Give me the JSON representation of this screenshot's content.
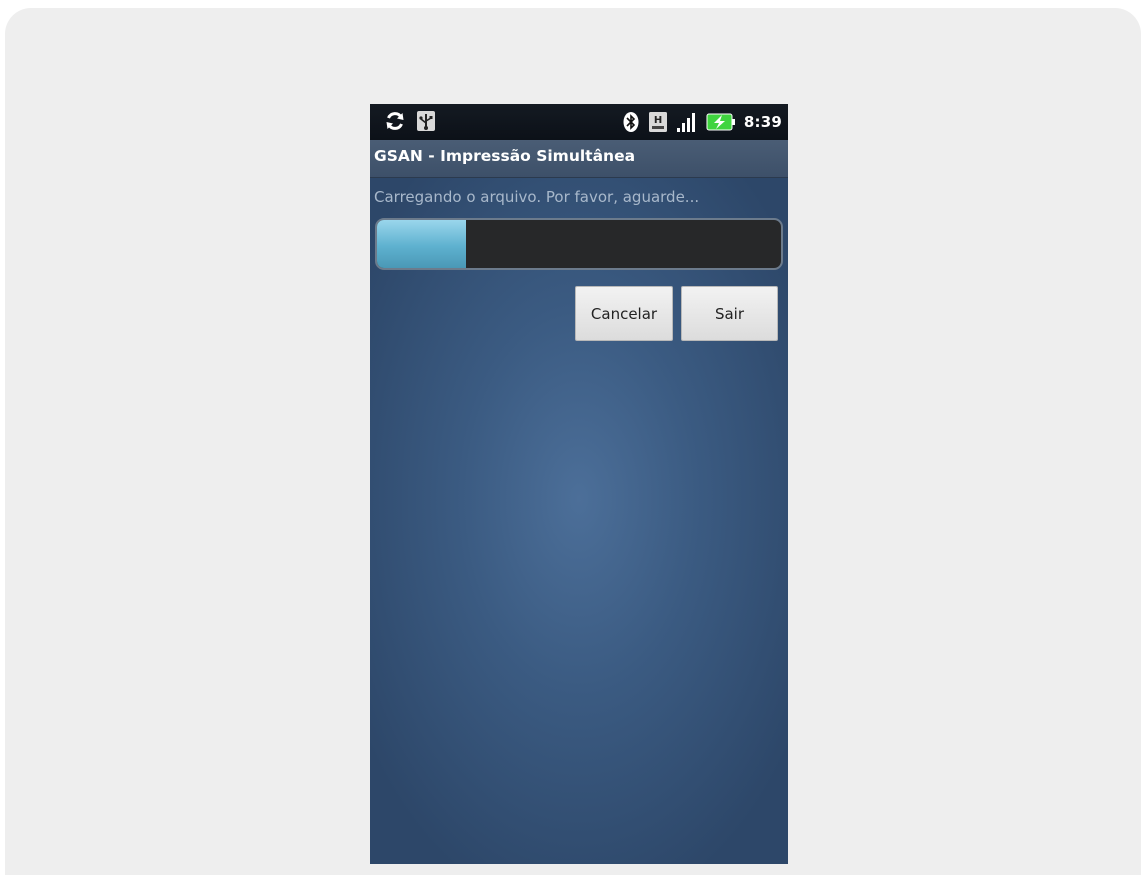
{
  "status_bar": {
    "time": "8:39",
    "icons": [
      "sync-icon",
      "usb-icon",
      "bluetooth-icon",
      "sim-h-icon",
      "signal-icon",
      "battery-charging-icon"
    ]
  },
  "app": {
    "title": "GSAN - Impressão Simultânea"
  },
  "dialog": {
    "message": "Carregando o arquivo. Por favor, aguarde...",
    "progress_percent": 22,
    "cancel_label": "Cancelar",
    "exit_label": "Sair"
  },
  "colors": {
    "progress_fill": "#5eb1cf",
    "background": "#3b5b82",
    "battery": "#3fd43f"
  }
}
